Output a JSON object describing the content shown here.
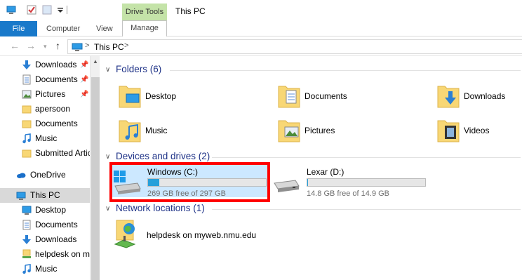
{
  "window": {
    "title": "This PC",
    "context_tab_group": "Drive Tools"
  },
  "ribbon": {
    "file_tab": "File",
    "tabs": [
      "Computer",
      "View"
    ],
    "manage_tab": "Manage"
  },
  "address_bar": {
    "location": "This PC"
  },
  "sidebar": {
    "quick_access": [
      {
        "label": "Downloads",
        "icon": "download-arrow-icon",
        "pinned": true
      },
      {
        "label": "Documents",
        "icon": "documents-icon",
        "pinned": true
      },
      {
        "label": "Pictures",
        "icon": "pictures-icon",
        "pinned": true
      },
      {
        "label": "apersoon",
        "icon": "folder-icon",
        "pinned": false
      },
      {
        "label": "Documents",
        "icon": "folder-icon",
        "pinned": false
      },
      {
        "label": "Music",
        "icon": "music-icon",
        "pinned": false
      },
      {
        "label": "Submitted Articl",
        "icon": "folder-icon",
        "pinned": false
      }
    ],
    "onedrive": "OneDrive",
    "this_pc": "This PC",
    "this_pc_children": [
      {
        "label": "Desktop",
        "icon": "desktop-icon"
      },
      {
        "label": "Documents",
        "icon": "documents-icon"
      },
      {
        "label": "Downloads",
        "icon": "download-arrow-icon"
      },
      {
        "label": "helpdesk on myv",
        "icon": "network-drive-icon"
      },
      {
        "label": "Music",
        "icon": "music-icon"
      }
    ]
  },
  "sections": {
    "folders_title": "Folders (6)",
    "devices_title": "Devices and drives (2)",
    "network_title": "Network locations (1)"
  },
  "folders": [
    {
      "label": "Desktop",
      "icon": "desktop-folder-icon"
    },
    {
      "label": "Documents",
      "icon": "documents-folder-icon"
    },
    {
      "label": "Downloads",
      "icon": "downloads-folder-icon"
    },
    {
      "label": "Music",
      "icon": "music-folder-icon"
    },
    {
      "label": "Pictures",
      "icon": "pictures-folder-icon"
    },
    {
      "label": "Videos",
      "icon": "videos-folder-icon"
    }
  ],
  "drives": [
    {
      "name": "Windows (C:)",
      "free": "269 GB free of 297 GB",
      "used_fraction": 0.094,
      "icon": "windows-drive-icon",
      "selected": true
    },
    {
      "name": "Lexar (D:)",
      "free": "14.8 GB free of 14.9 GB",
      "used_fraction": 0.007,
      "icon": "removable-drive-icon",
      "selected": false
    }
  ],
  "network_locations": [
    {
      "label": "helpdesk on myweb.nmu.edu",
      "icon": "network-location-icon"
    }
  ],
  "colors": {
    "accent": "#1979ca",
    "selection": "#cce8ff",
    "drive_bar": "#26a0da",
    "highlight": "#ff0000",
    "context_tab": "#c4e3a8"
  }
}
